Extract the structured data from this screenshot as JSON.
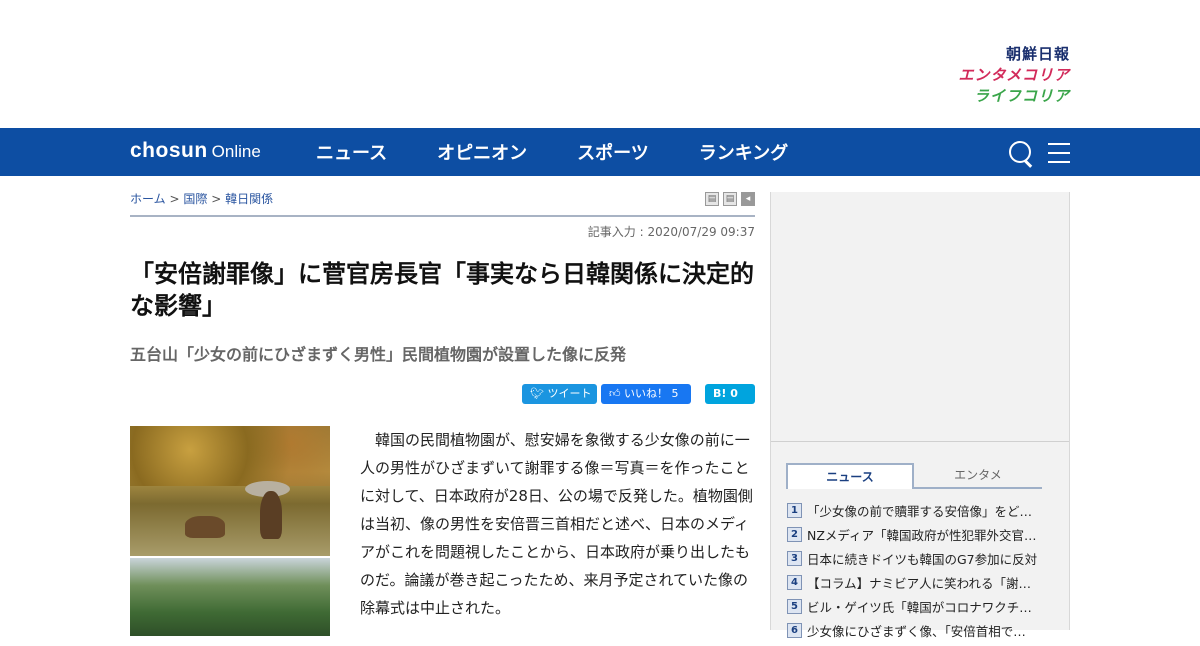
{
  "brands": [
    "朝鮮日報",
    "エンタメコリア",
    "ライフコリア"
  ],
  "nav": {
    "logo_main": "chosun",
    "logo_sub": "Online",
    "menu": [
      "ニュース",
      "オピニオン",
      "スポーツ",
      "ランキング"
    ]
  },
  "breadcrumb": {
    "home": "ホーム",
    "sep": ">",
    "cat1": "国際",
    "cat2": "韓日関係"
  },
  "tools": [
    "▤",
    "▤",
    "◂"
  ],
  "article": {
    "date": "記事入力 : 2020/07/29 09:37",
    "title": "「安倍謝罪像」に菅官房長官「事実なら日韓関係に決定的な影響」",
    "subtitle": "五台山「少女の前にひざまずく男性」民間植物園が設置した像に反発",
    "body": "韓国の民間植物園が、慰安婦を象徴する少女像の前に一人の男性がひざまずいて謝罪する像＝写真＝を作ったことに対して、日本政府が28日、公の場で反発した。植物園側は当初、像の男性を安倍晋三首相だと述べ、日本のメディアがこれを問題視したことから、日本政府が乗り出したものだ。論議が巻き起こったため、来月予定されていた像の除幕式は中止された。"
  },
  "share": {
    "tweet": "ツイート",
    "like": "いいね！ 5",
    "hatena": "B! 0"
  },
  "sidebar": {
    "tabs": [
      "ニュース",
      "エンタメ"
    ],
    "ranking": [
      {
        "num": "1",
        "text": "「少女像の前で贖罪する安倍像」をど…"
      },
      {
        "num": "2",
        "text": "NZメディア「韓国政府が性犯罪外交官…"
      },
      {
        "num": "3",
        "text": "日本に続きドイツも韓国のG7参加に反対"
      },
      {
        "num": "4",
        "text": "【コラム】ナミビア人に笑われる「謝…"
      },
      {
        "num": "5",
        "text": "ビル・ゲイツ氏「韓国がコロナワクチ…"
      },
      {
        "num": "6",
        "text": "少女像にひざまずく像、「安倍首相で…"
      }
    ]
  }
}
